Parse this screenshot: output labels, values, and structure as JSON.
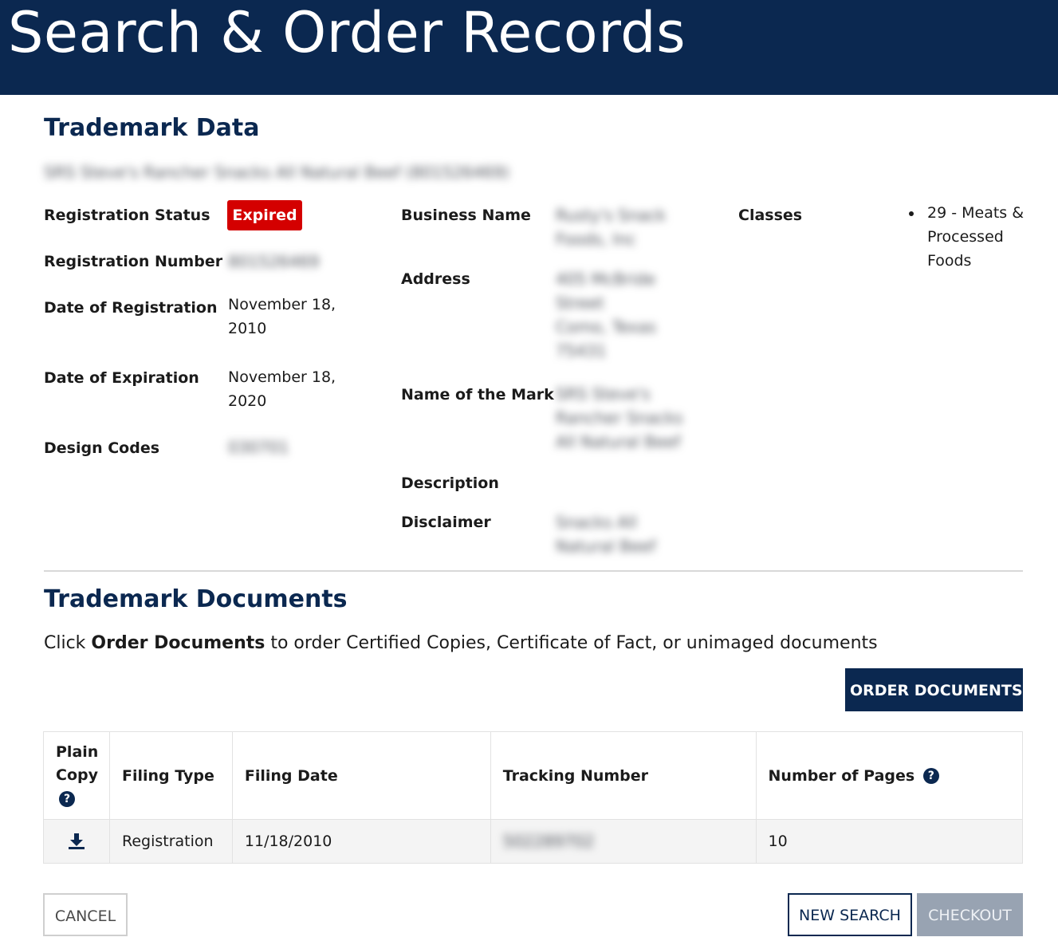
{
  "header": {
    "title": "Search & Order Records"
  },
  "trademark_data": {
    "title": "Trademark Data",
    "record_heading": "SRS Steve's Rancher Snacks All Natural Beef (801526469)",
    "fields": {
      "registration_status": {
        "label": "Registration Status",
        "value": "Expired"
      },
      "registration_number": {
        "label": "Registration Number",
        "value": "801526469"
      },
      "date_of_registration": {
        "label": "Date of Registration",
        "value": "November 18, 2010"
      },
      "date_of_expiration": {
        "label": "Date of Expiration",
        "value": "November 18, 2020"
      },
      "design_codes": {
        "label": "Design Codes",
        "value": "030701"
      },
      "business_name": {
        "label": "Business Name",
        "value": "Rusty's Snack Foods, Inc"
      },
      "address": {
        "label": "Address",
        "value": "405 McBride Street Como, Texas 75431"
      },
      "name_of_mark": {
        "label": "Name of the Mark",
        "value": "SRS Steve's Rancher Snacks All Natural Beef"
      },
      "description": {
        "label": "Description",
        "value": ""
      },
      "disclaimer": {
        "label": "Disclaimer",
        "value": "Snacks All Natural Beef"
      },
      "classes": {
        "label": "Classes",
        "items": [
          "29 - Meats & Processed Foods"
        ]
      }
    }
  },
  "trademark_documents": {
    "title": "Trademark Documents",
    "intro_prefix": "Click ",
    "intro_bold": "Order Documents",
    "intro_suffix": " to order Certified Copies, Certificate of Fact, or unimaged documents",
    "order_button": "ORDER DOCUMENTS",
    "table": {
      "headers": [
        "Plain Copy",
        "Filing Type",
        "Filing Date",
        "Tracking Number",
        "Number of Pages"
      ],
      "rows": [
        {
          "filing_type": "Registration",
          "filing_date": "11/18/2010",
          "tracking_number": "502289702",
          "pages": "10"
        }
      ]
    }
  },
  "actions": {
    "cancel": "CANCEL",
    "new_search": "NEW SEARCH",
    "checkout": "CHECKOUT"
  },
  "colors": {
    "brand": "#0b2850",
    "expired_badge": "#d40000",
    "disabled_button": "#98a3b2"
  },
  "icons": {
    "download": "download-icon",
    "help": "help-icon"
  }
}
